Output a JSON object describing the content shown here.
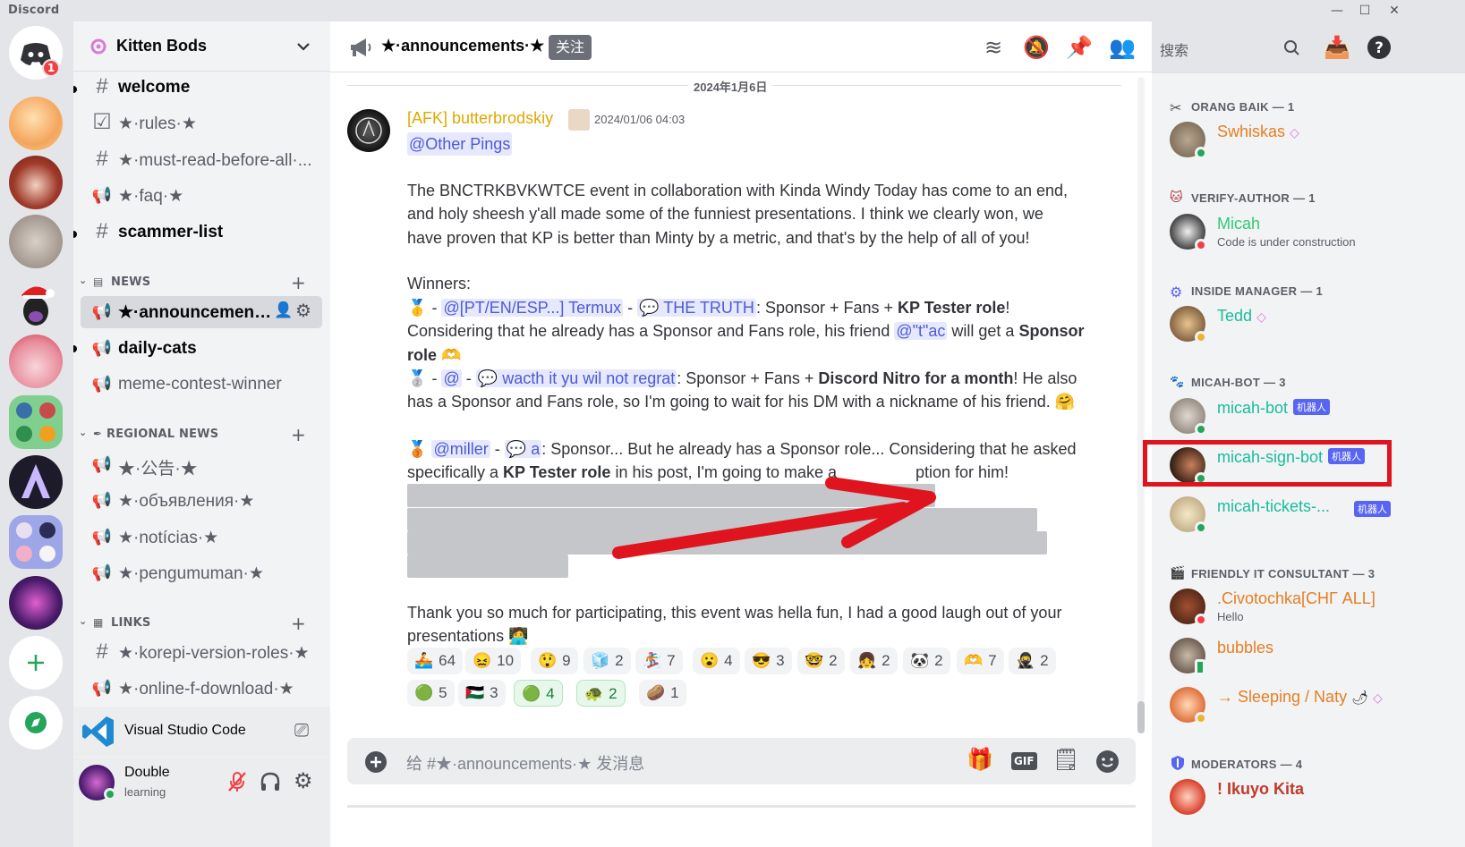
{
  "window": {
    "app_title": "Discord",
    "minimize": "—",
    "maximize": "☐",
    "close": "✕"
  },
  "rail": {
    "home_badge": "1"
  },
  "server": {
    "name": "Kitten Bods"
  },
  "channels": [
    {
      "label": "welcome",
      "icon": "#"
    },
    {
      "label": "★·rules·★",
      "icon": "☑"
    },
    {
      "label": "★·must-read-before-all·...",
      "icon": "#"
    },
    {
      "label": "★·faq·★",
      "icon": "📢"
    },
    {
      "label": "scammer-list",
      "icon": "#"
    },
    {
      "label": "★·announcements...",
      "icon": "📢"
    },
    {
      "label": "daily-cats",
      "icon": "📢"
    },
    {
      "label": "meme-contest-winner",
      "icon": "📢"
    },
    {
      "label": "★·公告·★",
      "icon": "📢"
    },
    {
      "label": "★·объявления·★",
      "icon": "📢"
    },
    {
      "label": "★·notícias·★",
      "icon": "📢"
    },
    {
      "label": "★·pengumuman·★",
      "icon": "📢"
    },
    {
      "label": "★·korepi-version-roles·★",
      "icon": "#"
    },
    {
      "label": "★·online-f-download·★",
      "icon": "📢"
    }
  ],
  "categories": {
    "news": "NEWS",
    "regional": "REGIONAL NEWS",
    "links": "LINKS"
  },
  "activity": {
    "label": "Visual Studio Code"
  },
  "user": {
    "name": "Double",
    "status": "learning"
  },
  "header": {
    "channel": "★·announcements·★",
    "follow": "关注",
    "search_placeholder": "搜索"
  },
  "message": {
    "date_divider": "2024年1月6日",
    "author": "[AFK] butterbrodskiy",
    "timestamp": "2024/01/06 04:03",
    "ping": "@Other Pings",
    "p1": "The BNCTRKBVKWTCE event in collaboration with Kinda Windy Today has come to an end, and holy sheesh y'all made some of the funniest presentations. I think we clearly won, we have proven that KP is better than Minty by a metric, and that's by the help of all of you!",
    "winners": "Winners:",
    "w1": {
      "m1": "@[PT/EN/ESP...] Termux",
      "m2": "THE TRUTH",
      "t1": ": Sponsor + Fans + ",
      "b1": "KP Tester role",
      "t2": "! Considering that he already has a Sponsor and Fans role, his friend ",
      "m3": "@\"t\"ac",
      "t3": " will get a ",
      "b2": "Sponsor role"
    },
    "w2": {
      "m1": "@",
      "m2": "wacth it yu wil not regrat",
      "t1": ": Sponsor + Fans + ",
      "b1": "Discord Nitro for a month",
      "t2": "! He also has a Sponsor and Fans role, so I'm going to wait for his DM with a nickname of his friend."
    },
    "w3": {
      "m1": "@miller",
      "m2": "a",
      "t1": ": Sponsor... But he already has a Sponsor role... Considering that he asked specifically a ",
      "b1": "KP Tester role",
      "t2": " in his post, I'm going to make a",
      "t3": "ption for him!"
    },
    "p2": "Thank you so much for participating, this event was hella fun, I had a good laugh out of your presentations",
    "dash": "-"
  },
  "reactions": [
    {
      "emoji": "🚣",
      "count": "64"
    },
    {
      "emoji": "😖",
      "count": "10"
    },
    {
      "emoji": "😲",
      "count": "9"
    },
    {
      "emoji": "🧊",
      "count": "2"
    },
    {
      "emoji": "🏂",
      "count": "7"
    },
    {
      "emoji": "😮",
      "count": "4"
    },
    {
      "emoji": "😎",
      "count": "3"
    },
    {
      "emoji": "🤓",
      "count": "2"
    },
    {
      "emoji": "👧",
      "count": "2"
    },
    {
      "emoji": "🐼",
      "count": "2"
    },
    {
      "emoji": "🫶",
      "count": "7"
    },
    {
      "emoji": "🥷",
      "count": "2"
    },
    {
      "emoji": "🟢",
      "count": "5"
    },
    {
      "emoji": "🇵🇸",
      "count": "3"
    },
    {
      "emoji": "🟢",
      "count": "4"
    },
    {
      "emoji": "🐢",
      "count": "2"
    },
    {
      "emoji": "🥔",
      "count": "1"
    }
  ],
  "composer": {
    "placeholder": "给 #★·announcements·★ 发消息",
    "gif": "GIF"
  },
  "members": {
    "roles": [
      "ORANG BAIK — 1",
      "VERIFY-AUTHOR — 1",
      "INSIDE MANAGER — 1",
      "MICAH-BOT — 3",
      "FRIENDLY IT CONSULTANT — 3",
      "MODERATORS — 4"
    ],
    "list": [
      {
        "name": "Swhiskas",
        "sub": "",
        "color": "#e67e22"
      },
      {
        "name": "Micah",
        "sub": "Code is under construction",
        "color": "#2ecc71"
      },
      {
        "name": "Tedd",
        "sub": "",
        "color": "#1abc9c"
      },
      {
        "name": "micah-bot",
        "sub": "",
        "color": "#1abc9c",
        "tag": "机器人"
      },
      {
        "name": "micah-sign-bot",
        "sub": "",
        "color": "#1abc9c",
        "tag": "机器人"
      },
      {
        "name": "micah-tickets-...",
        "sub": "",
        "color": "#1abc9c",
        "tag": "机器人"
      },
      {
        "name": ".Civotochka[СНГ ALL]",
        "sub": "Hello",
        "color": "#e67e22"
      },
      {
        "name": "bubbles",
        "sub": "",
        "color": "#e67e22"
      },
      {
        "name": "→ Sleeping / Naty",
        "sub": "",
        "color": "#e67e22"
      },
      {
        "name": "! Ikuyo Kita",
        "sub": "",
        "color": "#c0392b"
      }
    ]
  },
  "colors": {
    "accent": "#5865f2",
    "annotation_red": "#e0141e",
    "online": "#23a55a",
    "dnd": "#f23f43",
    "author": "#e0a800"
  }
}
